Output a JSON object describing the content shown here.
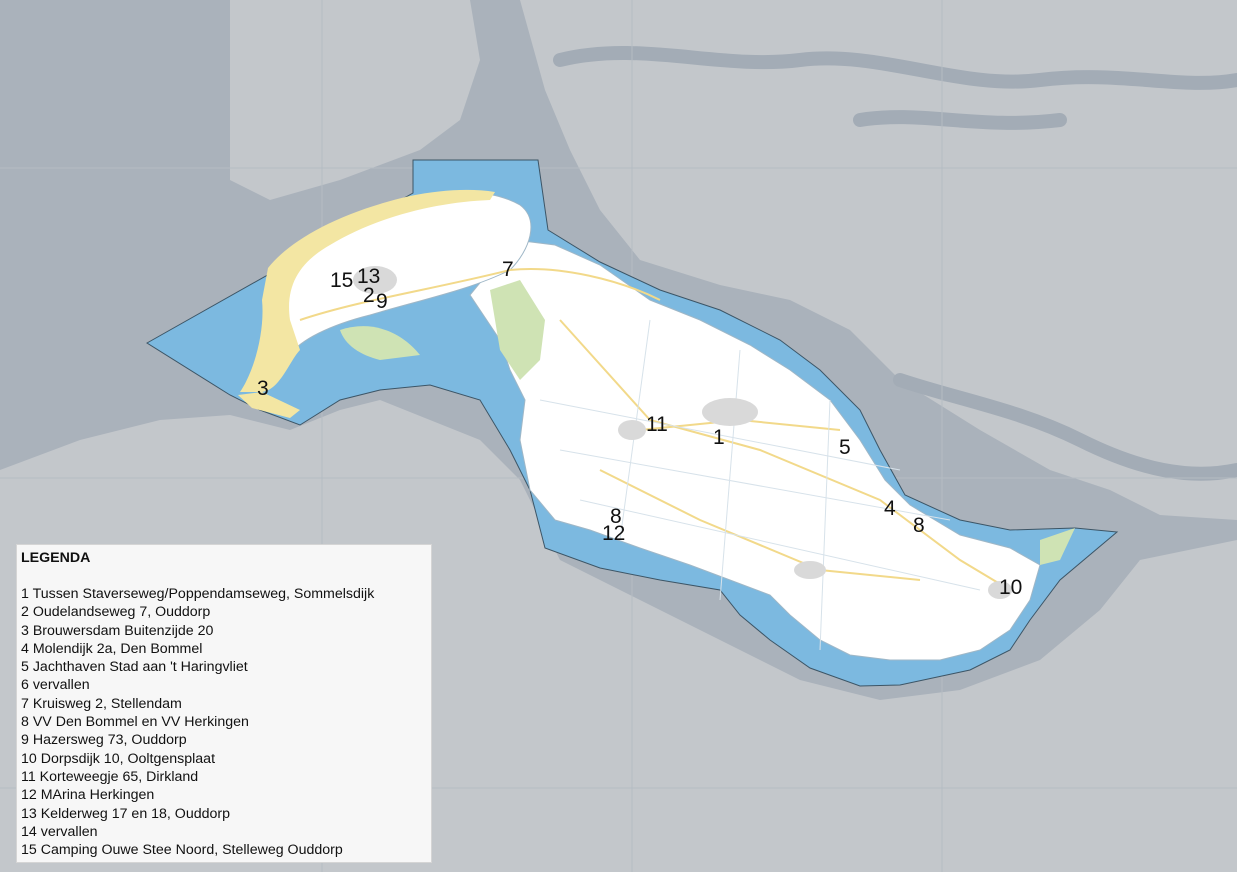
{
  "map": {
    "colors": {
      "background": "#aab2bb",
      "land_dark": "#c4c8cc",
      "water_highlight": "#7cb9e0",
      "island_land": "#ffffff",
      "dunes": "#f3e6a3",
      "green": "#cfe3b4",
      "roads": "#f2d98a"
    },
    "markers": [
      {
        "id": "m15",
        "label": "15"
      },
      {
        "id": "m13",
        "label": "13"
      },
      {
        "id": "m2",
        "label": "2"
      },
      {
        "id": "m9",
        "label": "9"
      },
      {
        "id": "m7",
        "label": "7"
      },
      {
        "id": "m3",
        "label": "3"
      },
      {
        "id": "m11",
        "label": "11"
      },
      {
        "id": "m1",
        "label": "1"
      },
      {
        "id": "m5",
        "label": "5"
      },
      {
        "id": "m4",
        "label": "4"
      },
      {
        "id": "m8a",
        "label": "8"
      },
      {
        "id": "m8b",
        "label": "8"
      },
      {
        "id": "m12",
        "label": "12"
      },
      {
        "id": "m10",
        "label": "10"
      }
    ]
  },
  "legend": {
    "title": "LEGENDA",
    "items": [
      "1 Tussen Staverseweg/Poppendamseweg, Sommelsdijk",
      "2 Oudelandseweg 7, Ouddorp",
      "3 Brouwersdam Buitenzijde 20",
      "4 Molendijk 2a, Den Bommel",
      "5 Jachthaven Stad aan 't Haringvliet",
      "6 vervallen",
      "7 Kruisweg 2, Stellendam",
      "8 VV Den Bommel en VV Herkingen",
      "9 Hazersweg 73, Ouddorp",
      "10 Dorpsdijk 10, Ooltgensplaat",
      "11 Korteweegje 65, Dirkland",
      "12 MArina Herkingen",
      "13 Kelderweg 17 en 18, Ouddorp",
      "14 vervallen",
      "15 Camping Ouwe Stee Noord, Stelleweg Ouddorp"
    ]
  }
}
